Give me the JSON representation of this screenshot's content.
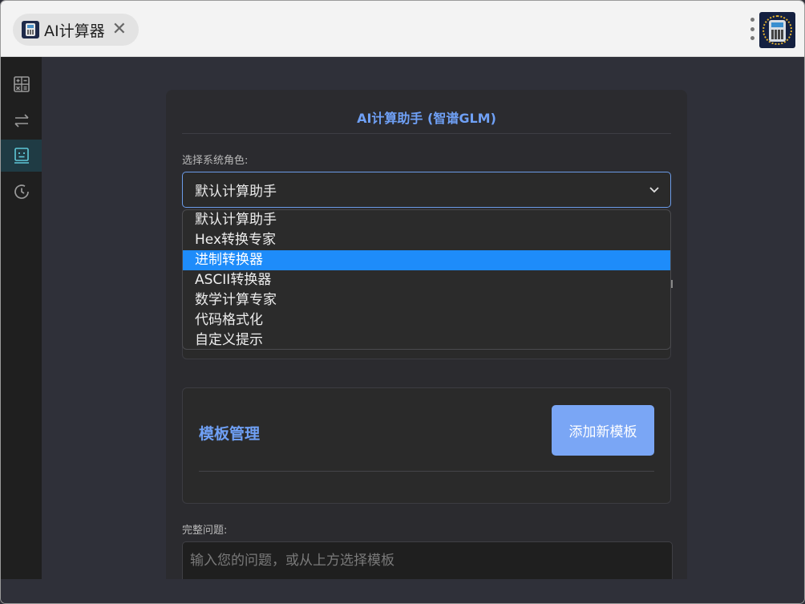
{
  "window": {
    "tab_title": "AI计算器",
    "tab_close": "✕"
  },
  "sidebar": {
    "items": [
      {
        "name": "calculator",
        "icon": "calculator-icon",
        "active": false
      },
      {
        "name": "converter",
        "icon": "swap-arrows-icon",
        "active": false
      },
      {
        "name": "ai-assistant",
        "icon": "robot-icon",
        "active": true
      },
      {
        "name": "history",
        "icon": "history-icon",
        "active": false
      }
    ]
  },
  "panel": {
    "title": "AI计算助手 (智谱GLM)",
    "role_label": "选择系统角色:",
    "role_selected": "默认计算助手",
    "role_options": [
      "默认计算助手",
      "Hex转换专家",
      "进制转换器",
      "ASCII转换器",
      "数学计算专家",
      "代码格式化",
      "自定义提示"
    ],
    "highlighted_option": "进制转换器"
  },
  "templates": {
    "title": "模板管理",
    "add_button": "添加新模板"
  },
  "question": {
    "label": "完整问题:",
    "placeholder": "输入您的问题，或从上方选择模板"
  },
  "colors": {
    "accent": "#6fa0f5",
    "selected_option": "#1e8cfa",
    "add_button": "#7aa6f5"
  }
}
